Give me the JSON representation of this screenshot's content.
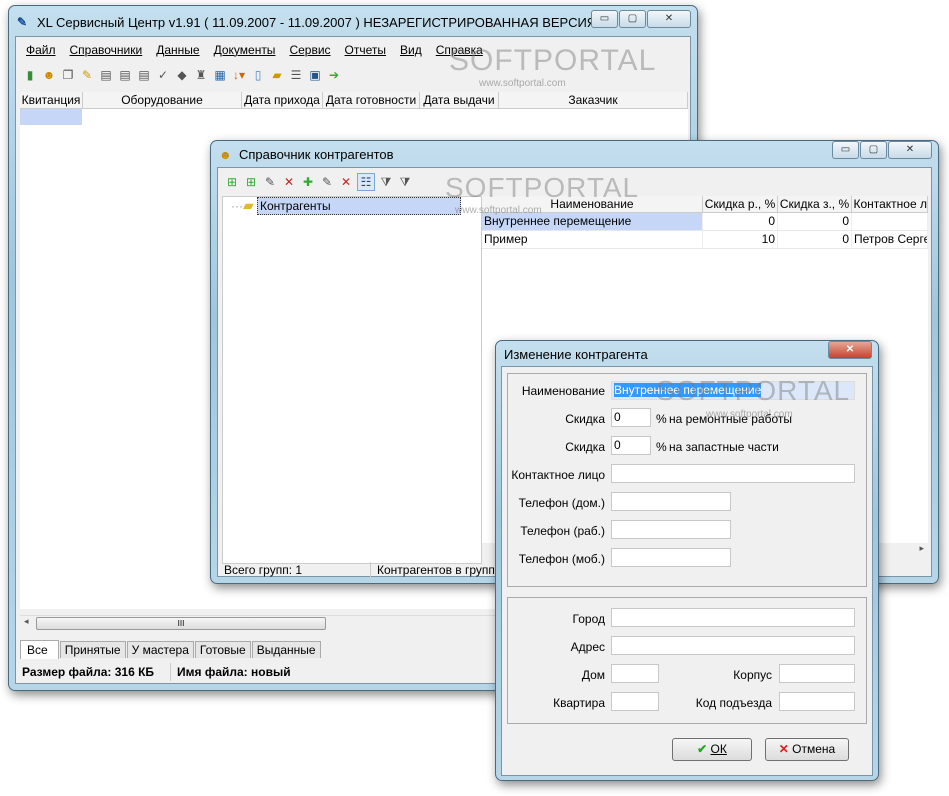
{
  "main": {
    "title": "XL Сервисный Центр v1.91    ( 11.09.2007 - 11.09.2007 ) НЕЗАРЕГИСТРИРОВАННАЯ ВЕРСИЯ",
    "menu": [
      "Файл",
      "Справочники",
      "Данные",
      "Документы",
      "Сервис",
      "Отчеты",
      "Вид",
      "Справка"
    ],
    "columns": [
      "Квитанция",
      "Оборудование",
      "Дата прихода",
      "Дата готовности",
      "Дата выдачи",
      "Заказчик"
    ],
    "tabs": [
      "Все",
      "Принятые",
      "У мастера",
      "Готовые",
      "Выданные"
    ],
    "status": {
      "size": "Размер файла: 316 КБ",
      "name": "Имя файла: новый"
    },
    "scroll_grip": "III"
  },
  "watermark": {
    "brand": "SOFTPORTAL",
    "url": "www.softportal.com"
  },
  "contragents": {
    "title": "Справочник контрагентов",
    "tree_root": "Контрагенты",
    "columns": [
      "Наименование",
      "Скидка р., %",
      "Скидка з., %",
      "Контактное л"
    ],
    "rows": [
      {
        "name": "Внутреннее перемещение",
        "d1": "0",
        "d2": "0",
        "contact": ""
      },
      {
        "name": "Пример",
        "d1": "10",
        "d2": "0",
        "contact": "Петров Сергей"
      }
    ],
    "status": {
      "groups": "Всего групп: 1",
      "in_group": "Контрагентов в группе"
    }
  },
  "dialog": {
    "title": "Изменение контрагента",
    "name_label": "Наименование",
    "name_value": "Внутреннее перемещение",
    "discount_label": "Скидка",
    "discount_repair": "0",
    "repair_suffix": "на ремонтные работы",
    "discount_parts": "0",
    "parts_suffix": "на запастные части",
    "percent": "%",
    "contact_label": "Контактное лицо",
    "phone_home": "Телефон (дом.)",
    "phone_work": "Телефон (раб.)",
    "phone_mobile": "Телефон (моб.)",
    "city": "Город",
    "address": "Адрес",
    "house": "Дом",
    "building": "Корпус",
    "flat": "Квартира",
    "entrance_code": "Код подъезда",
    "ok": "ОК",
    "cancel": "Отмена"
  }
}
